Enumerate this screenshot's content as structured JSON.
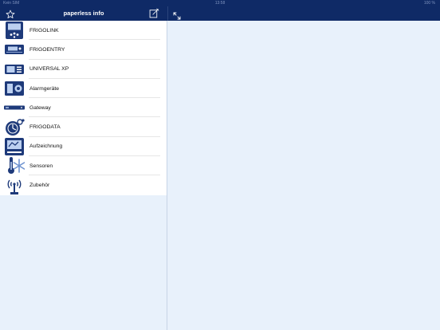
{
  "status": {
    "carrier": "Kein SIM",
    "time": "13:58",
    "battery": "100 %"
  },
  "nav": {
    "title": "paperless info",
    "favorite_icon": "star-icon",
    "edit_icon": "compose-icon",
    "expand_icon": "expand-icon"
  },
  "colors": {
    "bar": "#0f2a66",
    "background": "#e8f1fb",
    "icon": "#1e3a7a"
  },
  "list": {
    "items": [
      {
        "label": "FRIGOLINK",
        "icon": "frigolink-device-icon"
      },
      {
        "label": "FRIGOENTRY",
        "icon": "frigoentry-device-icon"
      },
      {
        "label": "UNIVERSAL XP",
        "icon": "universal-xp-device-icon"
      },
      {
        "label": "Alarmgeräte",
        "icon": "alarm-device-icon"
      },
      {
        "label": "Gateway",
        "icon": "gateway-icon"
      },
      {
        "label": "FRIGODATA",
        "icon": "frigodata-icon"
      },
      {
        "label": "Aufzeichnung",
        "icon": "recording-icon"
      },
      {
        "label": "Sensoren",
        "icon": "sensor-icon"
      },
      {
        "label": "Zubehör",
        "icon": "accessory-icon"
      }
    ]
  }
}
